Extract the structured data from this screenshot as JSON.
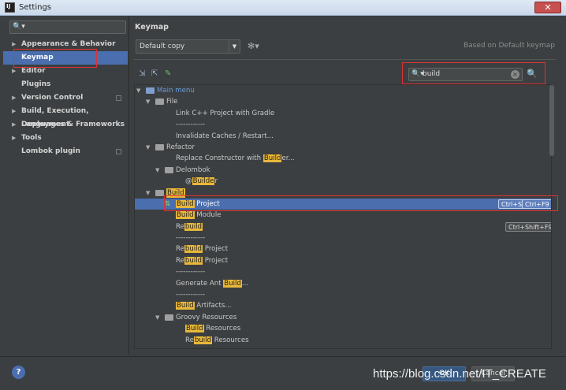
{
  "window": {
    "title": "Settings",
    "close": "✕"
  },
  "left": {
    "search_icon": "🔍▾",
    "items": [
      {
        "label": "Appearance & Behavior",
        "arrow": "▶"
      },
      {
        "label": "Keymap"
      },
      {
        "label": "Editor",
        "arrow": "▶"
      },
      {
        "label": "Plugins"
      },
      {
        "label": "Version Control",
        "arrow": "▶"
      },
      {
        "label": "Build, Execution, Deployment",
        "arrow": "▶"
      },
      {
        "label": "Languages & Frameworks",
        "arrow": "▶"
      },
      {
        "label": "Tools",
        "arrow": "▶"
      },
      {
        "label": "Lombok plugin"
      }
    ]
  },
  "keymap": {
    "title": "Keymap",
    "scheme": "Default copy",
    "gear": "✻▾",
    "based_on": "Based on Default keymap",
    "search_value": "build",
    "search_icon": "🔍▾",
    "clear": "×",
    "find_shortcut": "🔍"
  },
  "tree": {
    "root": "Main menu",
    "file": "File",
    "link_cpp": "Link C++ Project with Gradle",
    "sep": "------------",
    "invalidate": "Invalidate Caches / Restart...",
    "refactor": "Refactor",
    "replace_pre": "Replace Constructor with ",
    "replace_hl": "Build",
    "replace_post": "er...",
    "delombok": "Delombok",
    "at": "@",
    "delombok_hl": "Builde",
    "delombok_post": "r",
    "build_folder": "Build",
    "build_project_hl": "Build",
    "build_project_post": " Project",
    "sc1": "Ctrl+S",
    "sc2": "Ctrl+F9",
    "build_module_hl": "Build",
    "build_module_post": " Module",
    "re": "Re",
    "rebuild_hl": "build",
    "sc3": "Ctrl+Shift+F9",
    "re_project_hl": "build",
    "re_project_post": " Project",
    "generate_pre": "Generate Ant ",
    "generate_hl": "Build",
    "generate_post": "...",
    "artifacts_hl": "Build",
    "artifacts_post": " Artifacts...",
    "groovy": "Groovy Resources",
    "groovy_build_hl": "Build",
    "resources": " Resources"
  },
  "bottom": {
    "help": "?",
    "ok": "OK",
    "cancel": "Cancel",
    "watermark": "https://blog.csdn.net/IT_CREATE"
  }
}
